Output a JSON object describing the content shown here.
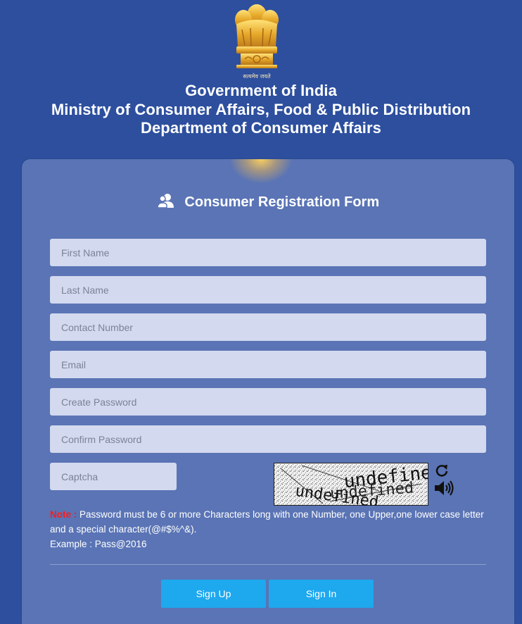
{
  "header": {
    "line1": "Government of India",
    "line2": "Ministry of Consumer Affairs, Food & Public Distribution",
    "line3": "Department of Consumer Affairs"
  },
  "emblem": {
    "motto": "सत्यमेव जयते"
  },
  "form": {
    "title": "Consumer Registration Form",
    "fields": {
      "first_name": "First Name",
      "last_name": "Last Name",
      "contact": "Contact Number",
      "email": "Email",
      "create_password": "Create Password",
      "confirm_password": "Confirm Password",
      "captcha": "Captcha"
    },
    "captcha_text": "undefined",
    "note_label": "Note :",
    "note_text": " Password must be 6 or more Characters long with one Number, one Upper,one lower case letter and a special character(@#$%^&).",
    "example": "Example : Pass@2016",
    "signup_label": "Sign Up",
    "signin_label": "Sign In"
  },
  "colors": {
    "page_bg": "#2d4f9e",
    "card_bg": "#5a74b5",
    "input_bg": "#d3d9ef",
    "button": "#1ea8ee",
    "note_red": "#ff1a1a"
  },
  "icons": {
    "title": "user-pair-icon",
    "refresh": "refresh-icon",
    "audio": "speaker-icon"
  }
}
